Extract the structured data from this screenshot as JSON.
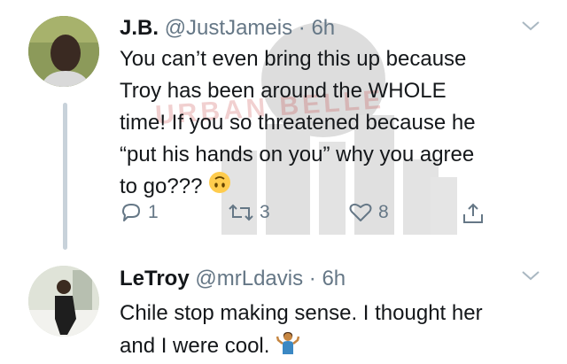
{
  "tweets": [
    {
      "display_name": "J.B.",
      "handle": "@JustJameis",
      "separator": "·",
      "time": "6h",
      "text_lines": [
        "You can’t even bring this up because",
        "Troy has been around the WHOLE",
        "time! If you so threatened because he",
        "“put his hands on you” why you agree",
        "to go???"
      ],
      "emoji": "upside-down-face",
      "reply_count": "1",
      "retweet_count": "3",
      "like_count": "8"
    },
    {
      "display_name": "LeTroy",
      "handle": "@mrLdavis",
      "separator": "·",
      "time": "6h",
      "text_lines": [
        "Chile stop making sense. I thought her",
        "and I were cool."
      ],
      "emoji": "person-shrugging"
    }
  ],
  "watermark": {
    "text": "URBAN BELLE"
  },
  "colors": {
    "text": "#14171a",
    "secondary": "#657786",
    "thread_line": "#c8d2da",
    "watermark": "#c23030"
  }
}
